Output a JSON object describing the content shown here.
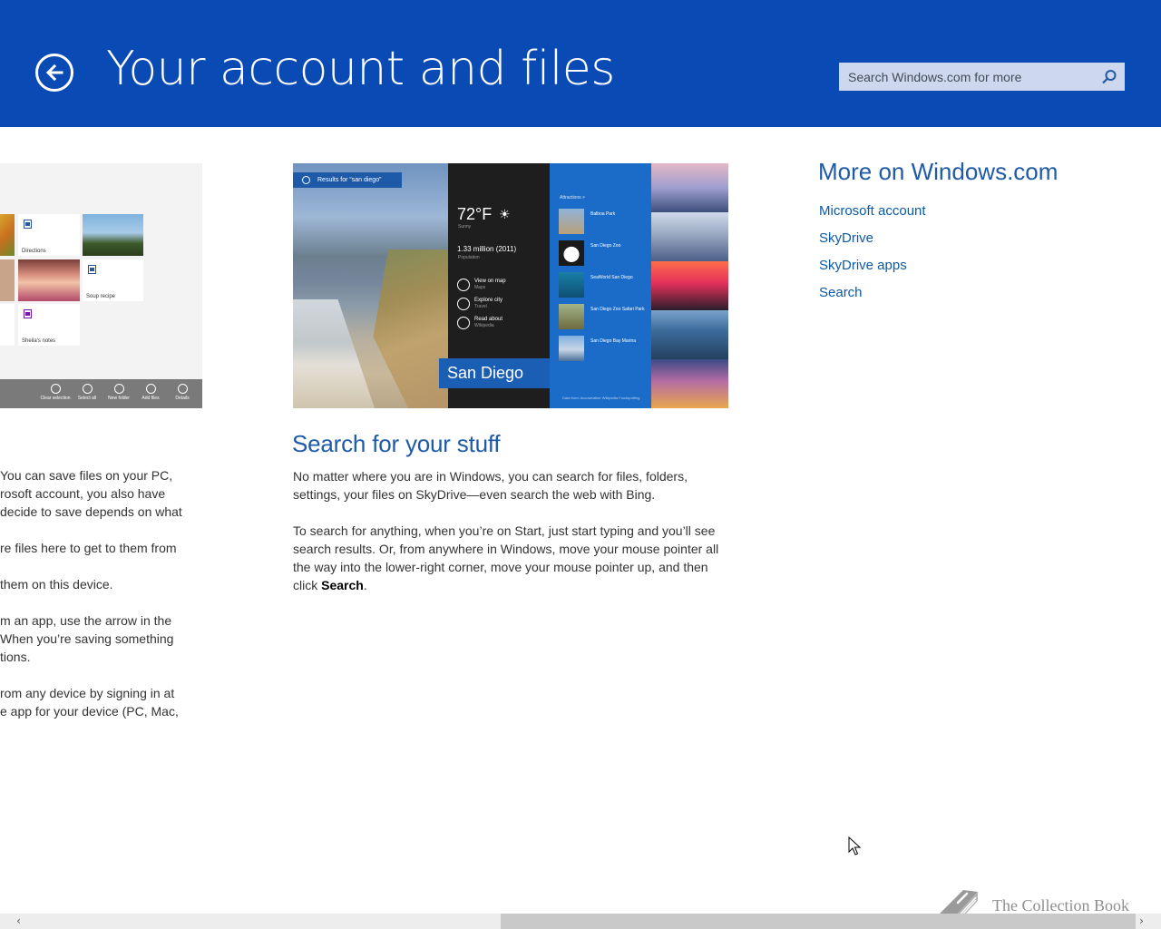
{
  "header": {
    "title": "Your account and files",
    "search_placeholder": "Search Windows.com for more",
    "background_color": "#0a4ab4"
  },
  "left_screenshot": {
    "tiles": [
      "Directions",
      "Soup recipe",
      "Sheila's notes"
    ],
    "appbar": [
      "Clear selection",
      "Select all",
      "New folder",
      "Add files",
      "Details"
    ]
  },
  "left_text": {
    "lines": [
      "You can save files on your PC,",
      "rosoft account, you also have",
      "decide to save depends on what",
      "re files here to get to them from",
      "them on this device.",
      "m an app, use the arrow in the",
      " When you’re saving something",
      "tions.",
      "rom any device by signing in at",
      "e app for your device (PC, Mac,"
    ]
  },
  "center_screenshot": {
    "results_chip": "Results for “san diego”",
    "temperature": "72°F",
    "weather_sub": "Sunny",
    "population": "1.33 million (2011)",
    "population_sub": "Population",
    "actions": [
      {
        "label": "View on map",
        "sub": "Maps"
      },
      {
        "label": "Explore city",
        "sub": "Travel"
      },
      {
        "label": "Read about",
        "sub": "Wikipedia"
      }
    ],
    "city_label": "San Diego",
    "attractions_heading": "Attractions >",
    "attractions": [
      "Balboa Park",
      "San Diego Zoo",
      "SeaWorld San Diego",
      "San Diego Zoo Safari Park",
      "San Diego Bay Marina"
    ],
    "footer": "Data from: Accuweather  Wikipedia  Foodspotting"
  },
  "article": {
    "title": "Search for your stuff",
    "para1": "No matter where you are in Windows, you can search for files, folders, settings, your files on SkyDrive—even search the web with Bing.",
    "para2_before": "To search for anything, when you’re on Start, just start typing and you’ll see search results. Or, from anywhere in Windows, move your mouse pointer all the way into the lower-right corner, move your mouse pointer up, and then click ",
    "para2_bold": "Search",
    "para2_after": "."
  },
  "sidebar": {
    "title": "More on Windows.com",
    "links": [
      "Microsoft account",
      "SkyDrive",
      "SkyDrive apps",
      "Search"
    ]
  },
  "watermark": {
    "text": "The Collection Book"
  },
  "scrollbar": {
    "left_arrow": "‹",
    "right_arrow": "›"
  },
  "colors": {
    "accent": "#1e5aa8",
    "link": "#0a5aa8",
    "header_bg": "#0a4ab4"
  },
  "icons": [
    "back-arrow-icon",
    "search-icon",
    "cursor-icon",
    "book-icon"
  ]
}
